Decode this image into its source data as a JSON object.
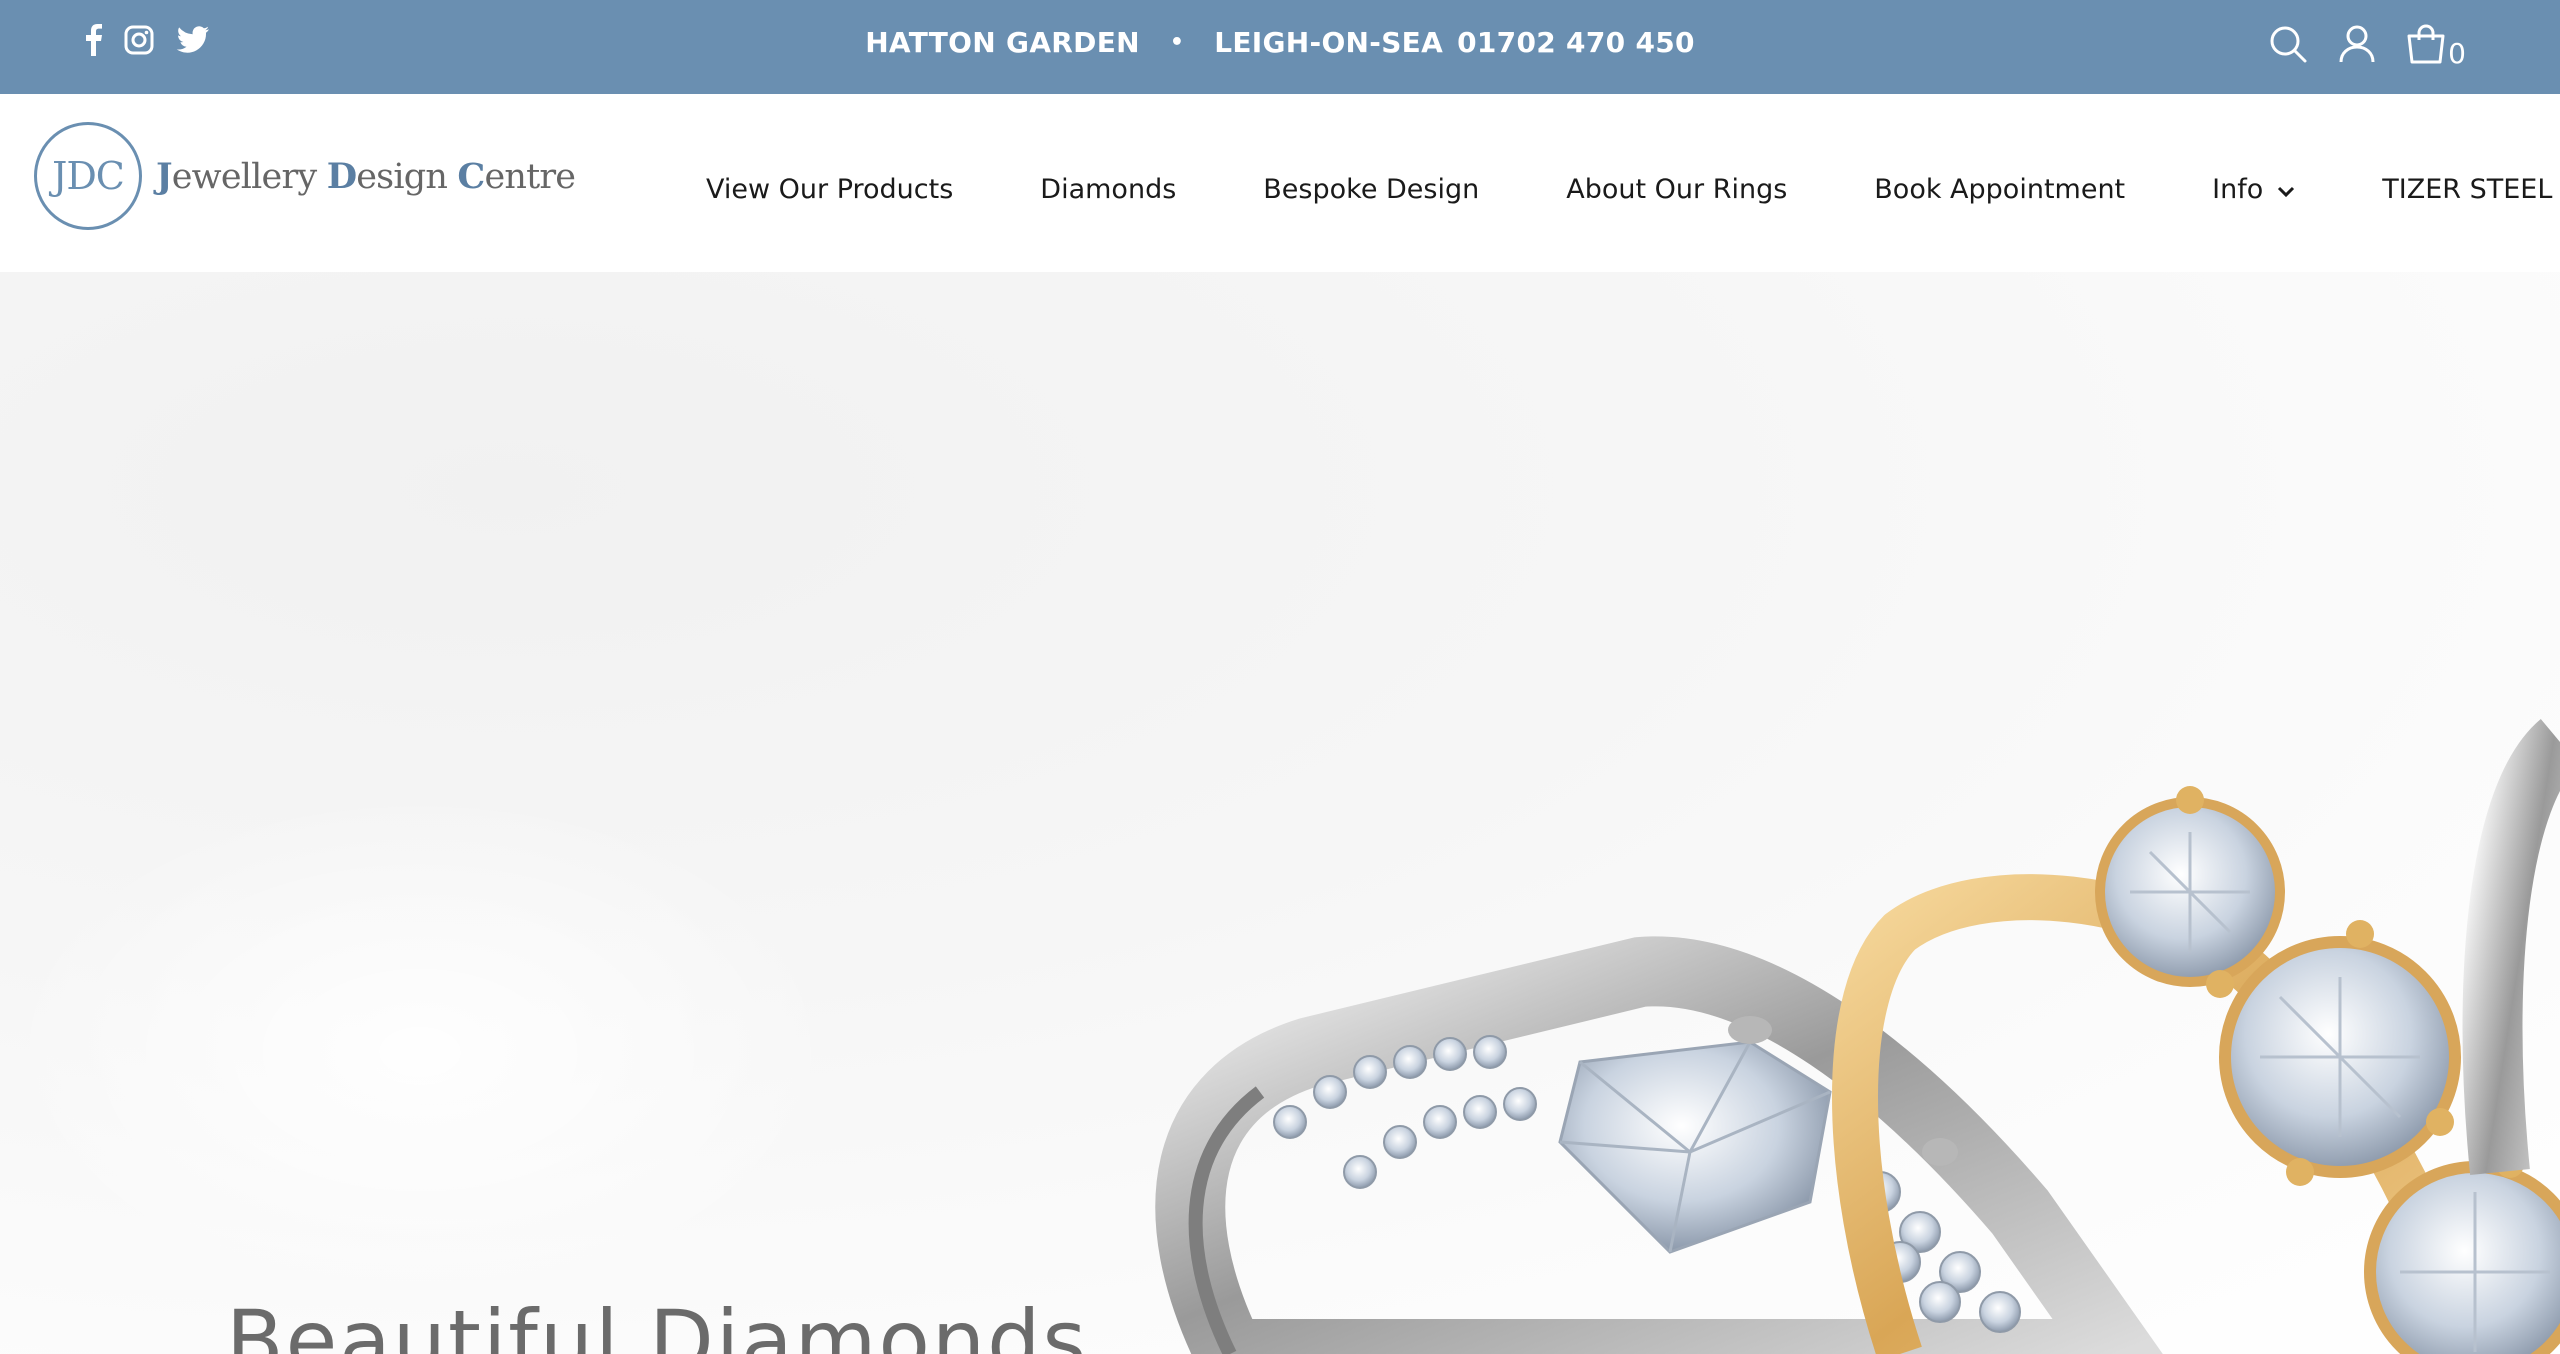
{
  "topbar": {
    "social": [
      "facebook-icon",
      "instagram-icon",
      "twitter-icon"
    ],
    "location1": "HATTON GARDEN",
    "separator": "•",
    "location2": "LEIGH-ON-SEA",
    "phone": "01702 470 450",
    "tools": [
      "search-icon",
      "account-icon",
      "cart-icon"
    ],
    "cart_count": "0",
    "background": "#6a8fb1"
  },
  "header": {
    "logo": {
      "initials": "JDC",
      "name": "Jewellery Design Centre"
    },
    "nav": [
      {
        "label": "View Our Products"
      },
      {
        "label": "Diamonds"
      },
      {
        "label": "Bespoke Design"
      },
      {
        "label": "About Our Rings"
      },
      {
        "label": "Book Appointment"
      },
      {
        "label": "Info",
        "dropdown": true
      },
      {
        "label": "TIZER STEEL",
        "dropdown": true
      }
    ]
  },
  "hero": {
    "title": "Beautiful Diamonds",
    "image": "diamond engagement rings"
  }
}
